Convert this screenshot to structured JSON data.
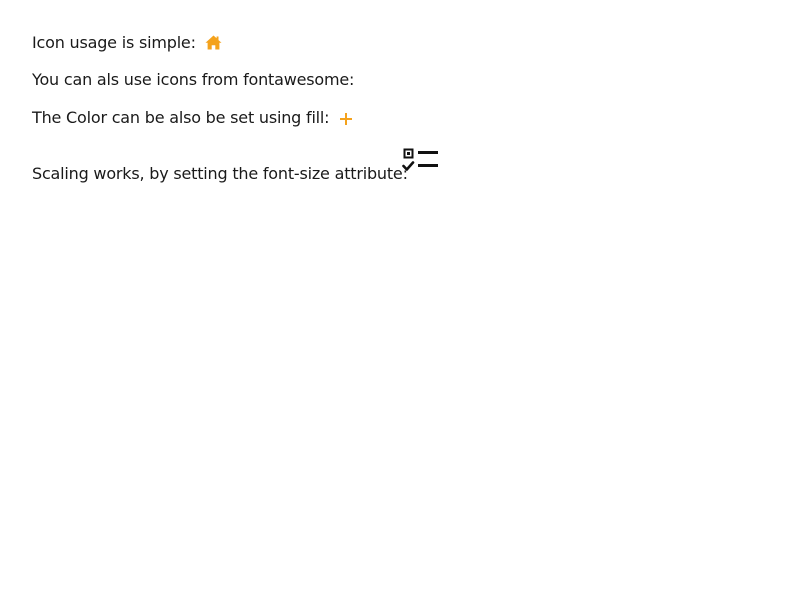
{
  "lines": {
    "icon_usage": "Icon usage is simple:",
    "fontawesome": "You can als use icons from fontawesome:",
    "color_fill": "The Color can be also be set using fill:",
    "scaling": "Scaling works, by setting the font-size attribute:"
  },
  "icons": {
    "home": {
      "name": "home-icon",
      "color": "#f4a21c"
    },
    "plus": {
      "name": "plus-icon",
      "color": "#f4a21c"
    },
    "tasks": {
      "name": "tasks-icon",
      "color": "#111111"
    }
  }
}
